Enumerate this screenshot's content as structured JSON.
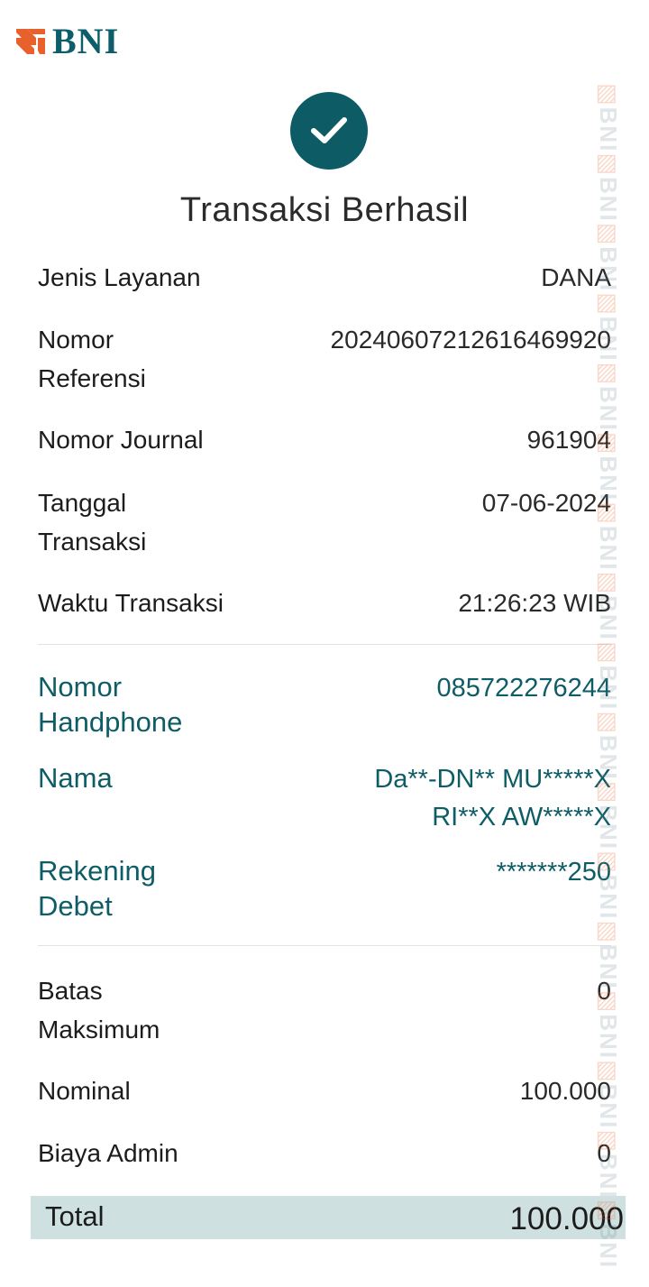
{
  "brand": {
    "logo_text": "BNI",
    "mark_color": "#e8602c",
    "text_color": "#0c5e6a"
  },
  "status": {
    "icon": "check-icon",
    "title": "Transaksi Berhasil",
    "circle_color": "#0d5c65"
  },
  "details": [
    {
      "label": "Jenis Layanan",
      "value": "DANA"
    },
    {
      "label": "Nomor\nReferensi",
      "value": "20240607212616469920"
    },
    {
      "label": "Nomor Journal",
      "value": "961904"
    },
    {
      "label": "Tanggal\nTransaksi",
      "value": "07-06-2024"
    },
    {
      "label": "Waktu Transaksi",
      "value": "21:26:23 WIB"
    }
  ],
  "recipient": [
    {
      "label": "Nomor\nHandphone",
      "value": "085722276244"
    },
    {
      "label": "Nama",
      "value": "Da**-DN** MU*****X\nRI**X AW*****X"
    },
    {
      "label": "Rekening\nDebet",
      "value": "*******250"
    }
  ],
  "amounts": [
    {
      "label": "Batas\nMaksimum",
      "value": "0"
    },
    {
      "label": "Nominal",
      "value": "100.000"
    },
    {
      "label": "Biaya Admin",
      "value": "0"
    }
  ],
  "total": {
    "label": "Total",
    "value": "100.000",
    "bar_color": "#cfe0e1"
  },
  "watermark": {
    "text": "BNI"
  }
}
